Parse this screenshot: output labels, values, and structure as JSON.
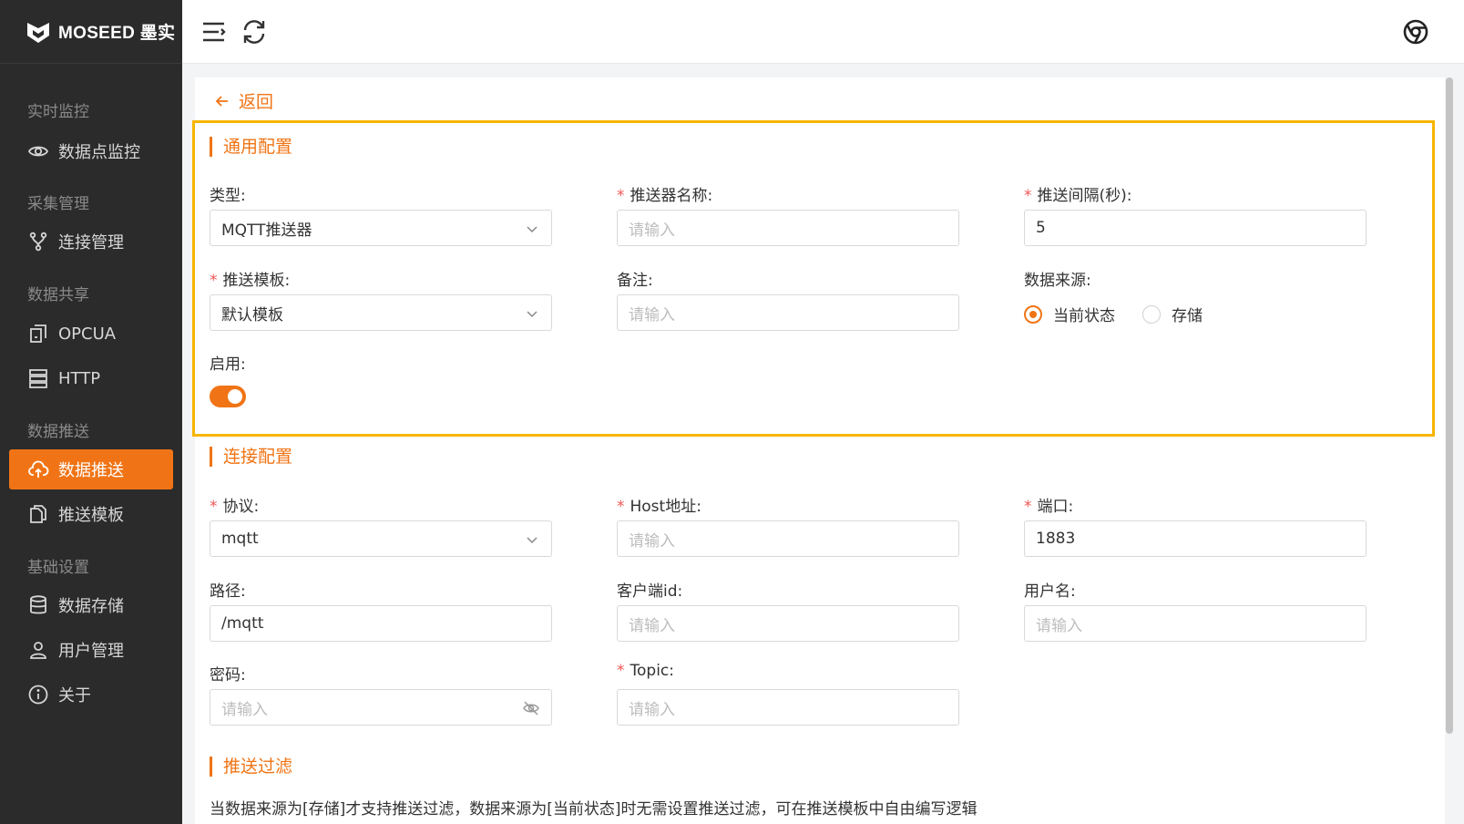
{
  "brand": {
    "name": "MOSEED 墨实"
  },
  "sidebar": {
    "groups": [
      {
        "label": "实时监控",
        "items": [
          {
            "label": "数据点监控",
            "icon": "eye-icon"
          }
        ]
      },
      {
        "label": "采集管理",
        "items": [
          {
            "label": "连接管理",
            "icon": "branch-icon"
          }
        ]
      },
      {
        "label": "数据共享",
        "items": [
          {
            "label": "OPCUA",
            "icon": "opcua-icon"
          },
          {
            "label": "HTTP",
            "icon": "server-icon"
          }
        ]
      },
      {
        "label": "数据推送",
        "items": [
          {
            "label": "数据推送",
            "icon": "cloud-upload-icon",
            "active": true
          },
          {
            "label": "推送模板",
            "icon": "copy-icon"
          }
        ]
      },
      {
        "label": "基础设置",
        "items": [
          {
            "label": "数据存储",
            "icon": "database-icon"
          },
          {
            "label": "用户管理",
            "icon": "user-icon"
          },
          {
            "label": "关于",
            "icon": "info-icon"
          }
        ]
      }
    ]
  },
  "back_label": "返回",
  "general": {
    "title": "通用配置",
    "type_label": "类型:",
    "type_value": "MQTT推送器",
    "name_label": "推送器名称:",
    "name_placeholder": "请输入",
    "interval_label": "推送间隔(秒):",
    "interval_value": "5",
    "template_label": "推送模板:",
    "template_value": "默认模板",
    "remark_label": "备注:",
    "remark_placeholder": "请输入",
    "source_label": "数据来源:",
    "source_options": [
      "当前状态",
      "存储"
    ],
    "source_selected": "当前状态",
    "enable_label": "启用:",
    "enabled": true
  },
  "connection": {
    "title": "连接配置",
    "protocol_label": "协议:",
    "protocol_value": "mqtt",
    "host_label": "Host地址:",
    "host_placeholder": "请输入",
    "port_label": "端口:",
    "port_value": "1883",
    "path_label": "路径:",
    "path_value": "/mqtt",
    "client_id_label": "客户端id:",
    "client_id_placeholder": "请输入",
    "username_label": "用户名:",
    "username_placeholder": "请输入",
    "password_label": "密码:",
    "password_placeholder": "请输入",
    "topic_label": "Topic:",
    "topic_placeholder": "请输入"
  },
  "filter": {
    "title": "推送过滤",
    "note": "当数据来源为[存储]才支持推送过滤，数据来源为[当前状态]时无需设置推送过滤，可在推送模板中自由编写逻辑"
  },
  "colors": {
    "accent": "#f07415",
    "sidebar_bg": "#2b2b2b",
    "highlight": "#f7b500",
    "required": "#f25555"
  }
}
